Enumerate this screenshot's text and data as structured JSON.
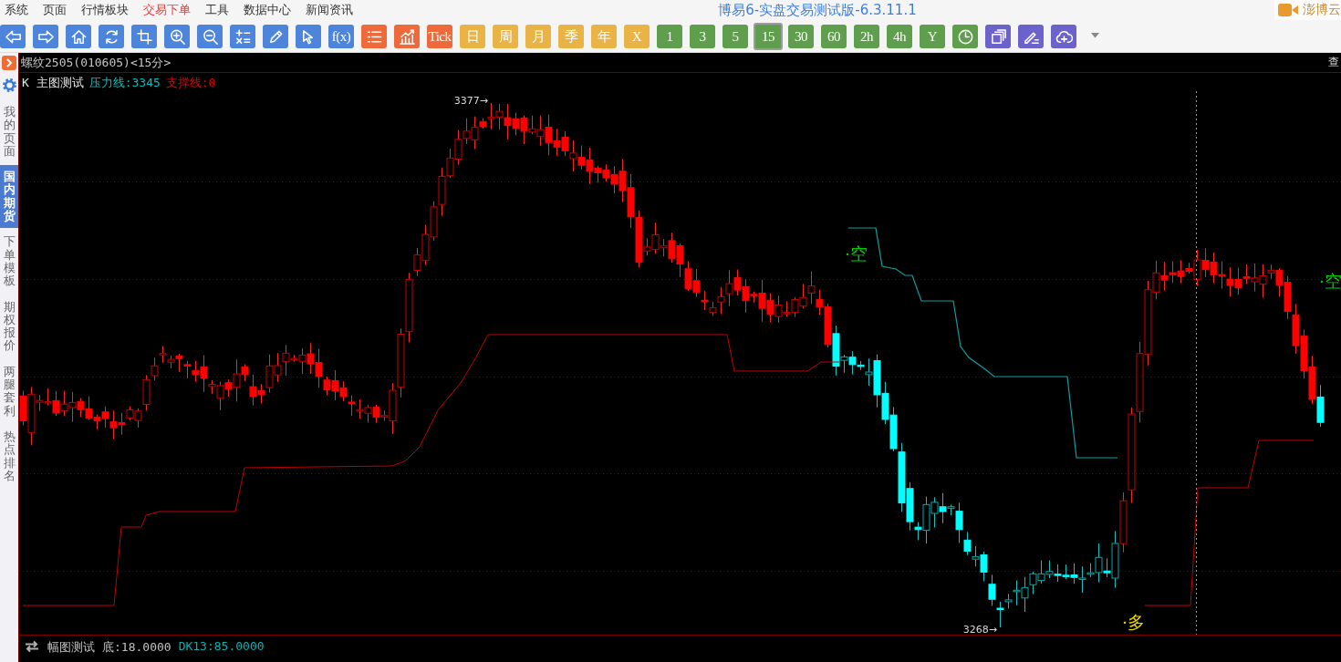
{
  "menu_bar": {
    "items": [
      {
        "label": "系统",
        "selected": false
      },
      {
        "label": "页面",
        "selected": false
      },
      {
        "label": "行情板块",
        "selected": false
      },
      {
        "label": "交易下单",
        "selected": true
      },
      {
        "label": "工具",
        "selected": false
      },
      {
        "label": "数据中心",
        "selected": false
      },
      {
        "label": "新闻资讯",
        "selected": false
      }
    ],
    "title": "博易6-实盘交易测试版-6.3.11.1",
    "brand": "澎博云"
  },
  "toolbar": {
    "buttons": [
      {
        "kind": "icon",
        "color": "#4d84dc",
        "selected": false
      },
      {
        "kind": "icon",
        "color": "#4d84dc",
        "selected": false
      },
      {
        "kind": "icon",
        "color": "#4d84dc",
        "selected": false
      },
      {
        "kind": "icon",
        "color": "#4d84dc",
        "selected": false
      },
      {
        "kind": "icon",
        "color": "#4d84dc",
        "selected": false
      },
      {
        "kind": "icon",
        "color": "#4d84dc",
        "selected": false
      },
      {
        "kind": "icon",
        "color": "#4d84dc",
        "selected": false
      },
      {
        "kind": "icon",
        "color": "#4d84dc",
        "selected": false
      },
      {
        "kind": "icon",
        "color": "#4d84dc",
        "selected": false
      },
      {
        "kind": "icon",
        "color": "#4d84dc",
        "selected": false
      },
      {
        "kind": "text",
        "label": "f(x)",
        "color": "#4d84dc",
        "selected": false
      },
      {
        "kind": "icon",
        "color": "#ee6a3a",
        "selected": false
      },
      {
        "kind": "icon",
        "color": "#ee6a3a",
        "selected": false
      },
      {
        "kind": "text",
        "label": "Tick",
        "color": "#ee6a3a",
        "selected": false
      },
      {
        "kind": "text",
        "label": "日",
        "color": "#e9b445",
        "selected": false
      },
      {
        "kind": "text",
        "label": "周",
        "color": "#e9b445",
        "selected": false
      },
      {
        "kind": "text",
        "label": "月",
        "color": "#e9b445",
        "selected": false
      },
      {
        "kind": "text",
        "label": "季",
        "color": "#e9b445",
        "selected": false
      },
      {
        "kind": "text",
        "label": "年",
        "color": "#e9b445",
        "selected": false
      },
      {
        "kind": "text",
        "label": "X",
        "color": "#e9b445",
        "selected": false
      },
      {
        "kind": "text",
        "label": "1",
        "color": "#5e9e4c",
        "selected": false
      },
      {
        "kind": "text",
        "label": "3",
        "color": "#5e9e4c",
        "selected": false
      },
      {
        "kind": "text",
        "label": "5",
        "color": "#5e9e4c",
        "selected": false
      },
      {
        "kind": "text",
        "label": "15",
        "color": "#5e9e4c",
        "selected": true
      },
      {
        "kind": "text",
        "label": "30",
        "color": "#5e9e4c",
        "selected": false
      },
      {
        "kind": "text",
        "label": "60",
        "color": "#5e9e4c",
        "selected": false
      },
      {
        "kind": "text",
        "label": "2h",
        "color": "#5e9e4c",
        "selected": false
      },
      {
        "kind": "text",
        "label": "4h",
        "color": "#5e9e4c",
        "selected": false
      },
      {
        "kind": "text",
        "label": "Y",
        "color": "#5e9e4c",
        "selected": false
      },
      {
        "kind": "icon",
        "color": "#5e9e4c",
        "selected": false
      },
      {
        "kind": "icon",
        "color": "#6c62cc",
        "selected": false
      },
      {
        "kind": "icon",
        "color": "#6c62cc",
        "selected": false
      },
      {
        "kind": "icon",
        "color": "#6c62cc",
        "selected": false
      },
      {
        "kind": "menu",
        "selected": false
      }
    ]
  },
  "sidebar": {
    "tabs": [
      {
        "label": "我的页面",
        "selected": false
      },
      {
        "label": "国内期货",
        "selected": true
      },
      {
        "label": "下单模板",
        "selected": false
      },
      {
        "label": "期权报价",
        "selected": false
      },
      {
        "label": "两腿套利",
        "selected": false
      },
      {
        "label": "热点排名",
        "selected": false
      }
    ]
  },
  "chart": {
    "title": "螺纹2505(010605)<15分>",
    "corner_text": "查",
    "indicator": {
      "name": "K 主图测试",
      "values": [
        {
          "text": "压力线:3345",
          "color": "#00c0c0"
        },
        {
          "text": "支撑线:0",
          "color": "#e00000"
        }
      ]
    },
    "annotations": [
      "3377→",
      "3268→"
    ],
    "signals": [
      {
        "text": "·空",
        "color": "#00cc00"
      },
      {
        "text": "·多",
        "color": "#e6d200"
      },
      {
        "text": "·空",
        "color": "#00cc00"
      }
    ]
  },
  "sub_indicator": {
    "name": "幅图测试",
    "values": [
      {
        "text": "底:18.0000",
        "color": "#c0c0c0"
      },
      {
        "text": "DK13:85.0000",
        "color": "#00b4b4"
      }
    ]
  }
}
